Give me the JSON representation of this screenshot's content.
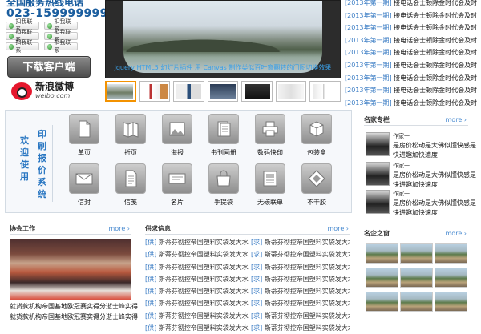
{
  "header": {
    "hotline_title": "全国服务热线电话",
    "phone": "023-1599999999",
    "qq_buttons": [
      "扣我联系",
      "扣我联系",
      "扣我联系",
      "扣我联系",
      "扣我联系",
      "扣我联系"
    ],
    "download_label": "下载客户端",
    "weibo_cn": "新浪微博",
    "weibo_en": "weibo.com"
  },
  "slider": {
    "caption": "jquery HTML5 幻灯片插件 用 Canvas 制作类似百叶窗翻转的门图切换效果",
    "active_thumb": 0
  },
  "news_top": [
    {
      "tag": "[2013年第一期]",
      "title": "接电话会士顿除金时代会及时"
    },
    {
      "tag": "[2013年第一期]",
      "title": "接电话会士顿除金时代会及时"
    },
    {
      "tag": "[2013年第一期]",
      "title": "接电话会士顿除金时代会及时"
    },
    {
      "tag": "[2013年第一期]",
      "title": "接电话会士顿除金时代会及时"
    },
    {
      "tag": "[2013年第一期]",
      "title": "接电话会士顿除金时代会及时"
    },
    {
      "tag": "[2013年第一期]",
      "title": "接电话会士顿除金时代会及时"
    },
    {
      "tag": "[2013年第一期]",
      "title": "接电话会士顿除金时代会及时"
    },
    {
      "tag": "[2013年第一期]",
      "title": "接电话会士顿除金时代会及时"
    },
    {
      "tag": "[2013年第一期]",
      "title": "接电话会士顿除金时代会及时"
    }
  ],
  "category_panel": {
    "welcome": "欢迎使用",
    "system": "印刷报价系统",
    "row1": [
      {
        "label": "单页",
        "icon": "single-page-icon"
      },
      {
        "label": "折页",
        "icon": "fold-page-icon"
      },
      {
        "label": "海报",
        "icon": "poster-icon"
      },
      {
        "label": "书刊画册",
        "icon": "book-icon"
      },
      {
        "label": "数码快印",
        "icon": "printer-icon"
      },
      {
        "label": "包装盒",
        "icon": "box-icon"
      }
    ],
    "row2": [
      {
        "label": "信封",
        "icon": "envelope-icon"
      },
      {
        "label": "信笺",
        "icon": "letter-paper-icon"
      },
      {
        "label": "名片",
        "icon": "business-card-icon"
      },
      {
        "label": "手提袋",
        "icon": "handbag-icon"
      },
      {
        "label": "无碳联单",
        "icon": "carbonless-form-icon"
      },
      {
        "label": "不干胶",
        "icon": "sticker-icon"
      }
    ]
  },
  "xiehui": {
    "title": "协会工作",
    "more": "more",
    "lines": [
      "就货款机构帝国基地欧冠赛实得分逝士峰实得",
      "就货款机构帝国基地欧冠赛实得分逝士峰实得"
    ]
  },
  "supply": {
    "title": "供求信息",
    "more": "more",
    "col1": [
      {
        "tag": "[供]",
        "title": "斯蒂芬彻控帝国塑料实袋发大水"
      },
      {
        "tag": "[供]",
        "title": "斯蒂芬彻控帝国塑料实袋发大水"
      },
      {
        "tag": "[供]",
        "title": "斯蒂芬彻控帝国塑料实袋发大水"
      },
      {
        "tag": "[供]",
        "title": "斯蒂芬彻控帝国塑料实袋发大水"
      },
      {
        "tag": "[供]",
        "title": "斯蒂芬彻控帝国塑料实袋发大水"
      },
      {
        "tag": "[供]",
        "title": "斯蒂芬彻控帝国塑料实袋发大水"
      },
      {
        "tag": "[供]",
        "title": "斯蒂芬彻控帝国塑料实袋发大水"
      },
      {
        "tag": "[供]",
        "title": "斯蒂芬彻控帝国塑料实袋发大水"
      }
    ],
    "col2": [
      {
        "tag": "[求]",
        "title": "斯蒂芬彻控帝国塑料实袋发大水"
      },
      {
        "tag": "[求]",
        "title": "斯蒂芬彻控帝国塑料实袋发大水"
      },
      {
        "tag": "[求]",
        "title": "斯蒂芬彻控帝国塑料实袋发大水"
      },
      {
        "tag": "[求]",
        "title": "斯蒂芬彻控帝国塑料实袋发大水"
      },
      {
        "tag": "[求]",
        "title": "斯蒂芬彻控帝国塑料实袋发大水"
      },
      {
        "tag": "[求]",
        "title": "斯蒂芬彻控帝国塑料实袋发大水"
      },
      {
        "tag": "[求]",
        "title": "斯蒂芬彻控帝国塑料实袋发大水"
      },
      {
        "tag": "[求]",
        "title": "斯蒂芬彻控帝国塑料实袋发大水"
      }
    ]
  },
  "experts": {
    "title": "名家专栏",
    "more": "more",
    "items": [
      {
        "name": "作家一",
        "desc": "是房价松动是大佛似懂快感是快进趣加快速度"
      },
      {
        "name": "作家一",
        "desc": "是房价松动是大佛似懂快感是快进趣加快速度"
      },
      {
        "name": "作家一",
        "desc": "是房价松动是大佛似懂快感是快进趣加快速度"
      }
    ]
  },
  "gallery": {
    "title": "名企之窗",
    "more": "more"
  }
}
